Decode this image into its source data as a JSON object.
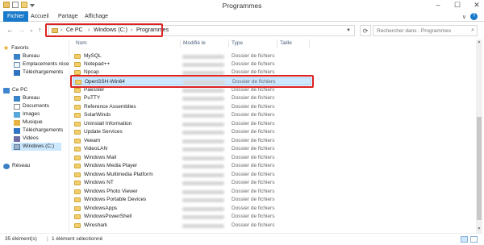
{
  "window": {
    "title": "Programmes",
    "controls": [
      "–",
      "☐",
      "✕"
    ]
  },
  "ribbon": {
    "tabs": [
      "Fichier",
      "Accueil",
      "Partage",
      "Affichage"
    ],
    "help": "?",
    "expand": "∨"
  },
  "address": {
    "crumbs": [
      "Ce PC",
      "Windows (C:)",
      "Programmes"
    ],
    "separator": "›",
    "search_placeholder": "Rechercher dans : Programmes"
  },
  "nav": {
    "back": "←",
    "forward": "→",
    "recent": "⌄",
    "up": "↑",
    "refresh": "⟳"
  },
  "sidebar": {
    "favorites": "Favoris",
    "fav_items": [
      "Bureau",
      "Emplacements réce",
      "Téléchargements"
    ],
    "pc": "Ce PC",
    "pc_items": [
      "Bureau",
      "Documents",
      "Images",
      "Musique",
      "Téléchargements",
      "Vidéos",
      "Windows (C:)"
    ],
    "network": "Réseau"
  },
  "columns": {
    "name": "Nom",
    "modified": "Modifié le",
    "type": "Type",
    "size": "Taille"
  },
  "files": [
    {
      "name": "MySQL",
      "type": "Dossier de fichiers"
    },
    {
      "name": "Notepad++",
      "type": "Dossier de fichiers"
    },
    {
      "name": "Npcap",
      "type": "Dossier de fichiers"
    },
    {
      "name": "OpenSSH-Win64",
      "type": "Dossier de fichiers",
      "selected": true
    },
    {
      "name": "Paessler",
      "type": "Dossier de fichiers"
    },
    {
      "name": "PuTTY",
      "type": "Dossier de fichiers"
    },
    {
      "name": "Reference Assemblies",
      "type": "Dossier de fichiers"
    },
    {
      "name": "SolarWinds",
      "type": "Dossier de fichiers"
    },
    {
      "name": "Uninstall Information",
      "type": "Dossier de fichiers"
    },
    {
      "name": "Update Services",
      "type": "Dossier de fichiers"
    },
    {
      "name": "Veeam",
      "type": "Dossier de fichiers"
    },
    {
      "name": "VideoLAN",
      "type": "Dossier de fichiers"
    },
    {
      "name": "Windows Mail",
      "type": "Dossier de fichiers"
    },
    {
      "name": "Windows Media Player",
      "type": "Dossier de fichiers"
    },
    {
      "name": "Windows Multimedia Platform",
      "type": "Dossier de fichiers"
    },
    {
      "name": "Windows NT",
      "type": "Dossier de fichiers"
    },
    {
      "name": "Windows Photo Viewer",
      "type": "Dossier de fichiers"
    },
    {
      "name": "Windows Portable Devices",
      "type": "Dossier de fichiers"
    },
    {
      "name": "WindowsApps",
      "type": "Dossier de fichiers"
    },
    {
      "name": "WindowsPowerShell",
      "type": "Dossier de fichiers"
    },
    {
      "name": "Wireshark",
      "type": "Dossier de fichiers"
    }
  ],
  "status": {
    "count": "35 élément(s)",
    "selection": "1 élément sélectionné"
  },
  "colors": {
    "accent": "#1979ca",
    "selection": "#cde8ff",
    "highlight_box": "#dd2222"
  }
}
